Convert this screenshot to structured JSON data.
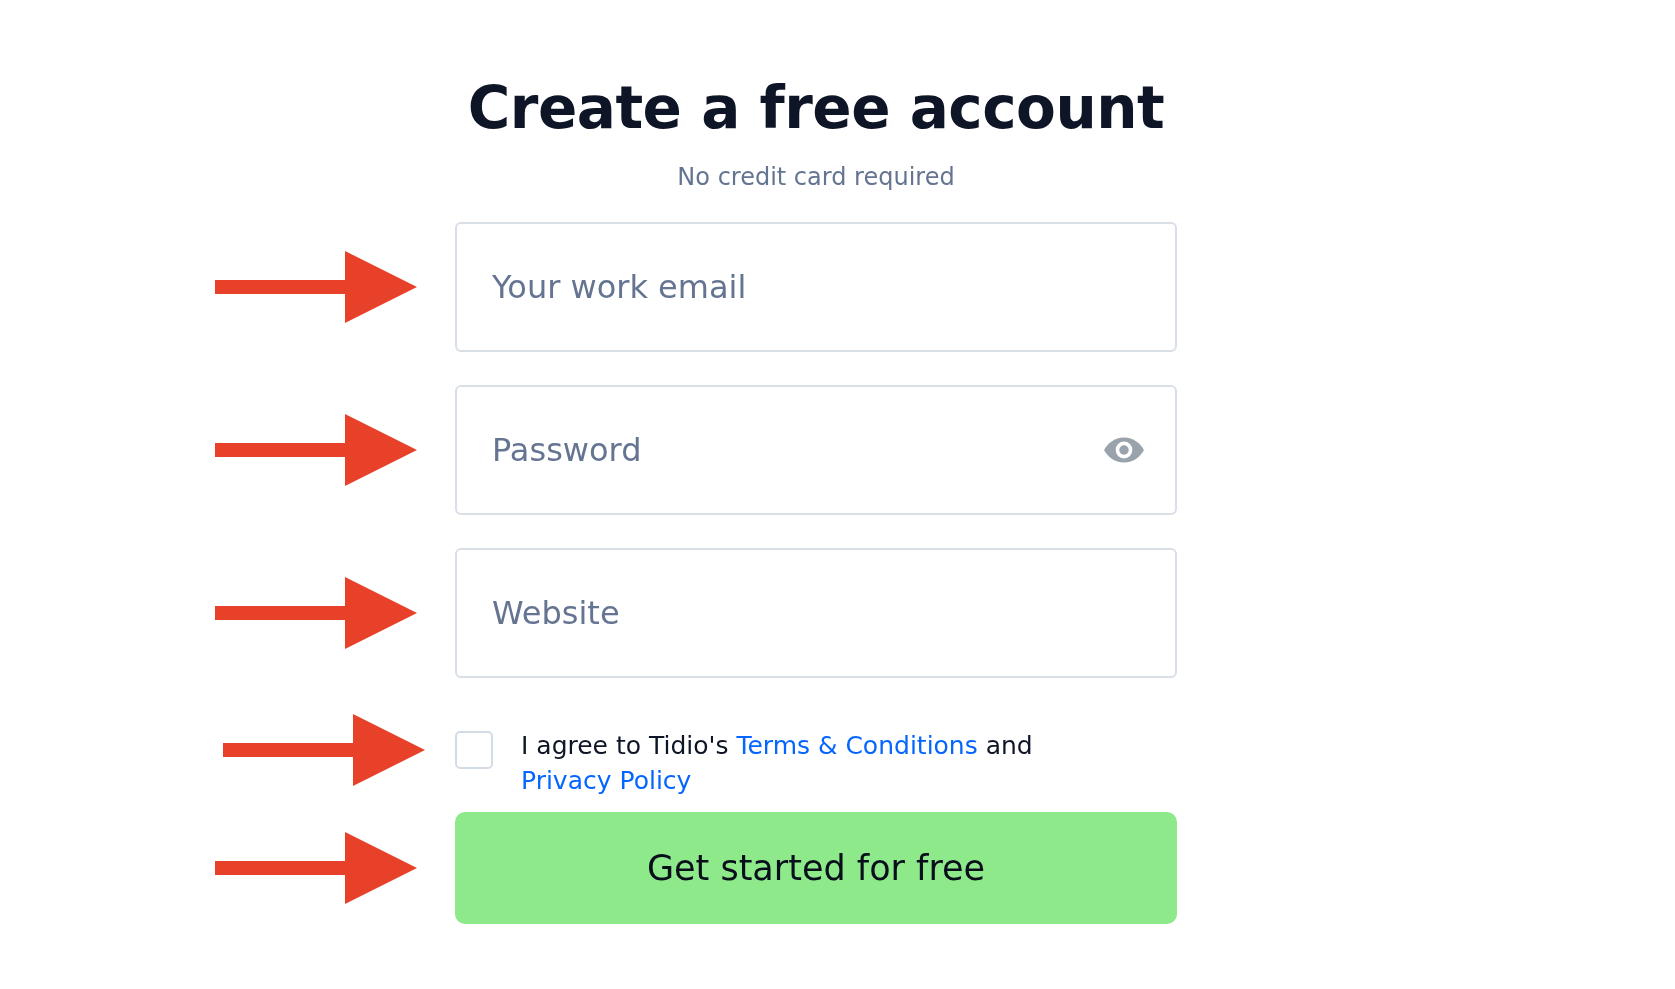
{
  "title": "Create a free account",
  "subtitle": "No credit card required",
  "fields": [
    {
      "kind": "email",
      "placeholder": "Your work email"
    },
    {
      "kind": "password",
      "placeholder": "Password"
    },
    {
      "kind": "text",
      "placeholder": "Website"
    }
  ],
  "agreement": {
    "checked": false,
    "text_before": "I agree to Tidio's",
    "terms_link": "Terms & Conditions",
    "text_between": "and",
    "privacy_link": "Privacy Policy"
  },
  "submit_button": "Get started for free"
}
